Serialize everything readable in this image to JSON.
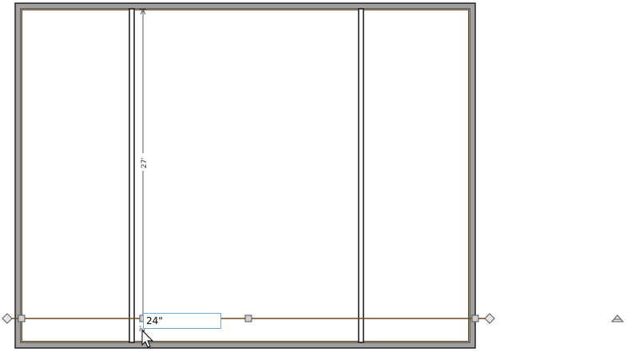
{
  "plan": {
    "vertical_dimension_label": "27'",
    "small_dimension_label": "2'",
    "edit_value": "24\""
  },
  "colors": {
    "wall_fill": "#a0a0a0",
    "wall_outline": "#222222",
    "beam_line": "#6b4a1f",
    "selection_box": "#6fa8dc",
    "dimension_line": "#555555"
  },
  "icons": {
    "left_handle": "diamond-handle-icon",
    "right_handle": "diamond-handle-icon",
    "corner_handle": "triangle-handle-icon",
    "cursor": "mouse-pointer-icon"
  }
}
